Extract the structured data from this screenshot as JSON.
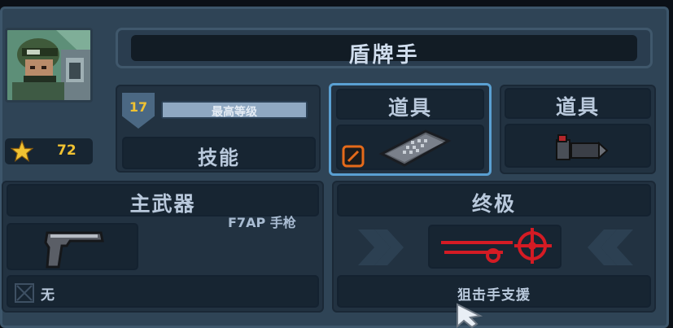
{
  "character": {
    "name": "盾牌手",
    "stars": "72",
    "level": "17",
    "level_status": "最高等级",
    "level_progress": 1.0,
    "skill_label": "技能"
  },
  "items": {
    "slot1_label": "道具",
    "slot2_label": "道具"
  },
  "primary_weapon": {
    "header": "主武器",
    "name": "F7AP 手枪",
    "secondary_label": "无"
  },
  "ultimate": {
    "header": "终极",
    "name": "狙击手支援"
  },
  "colors": {
    "star": "#f0c232",
    "ultimate_red": "#d41b24",
    "selected_border": "#5aa0d2"
  },
  "icons": [
    "star-icon",
    "level-shield-icon",
    "smoke-grenade-icon",
    "shield-plate-icon",
    "ammo-icon",
    "pistol-icon",
    "empty-slot-icon",
    "sniper-support-icon",
    "chevron-right-icon",
    "chevron-left-icon",
    "mouse-cursor-icon"
  ]
}
